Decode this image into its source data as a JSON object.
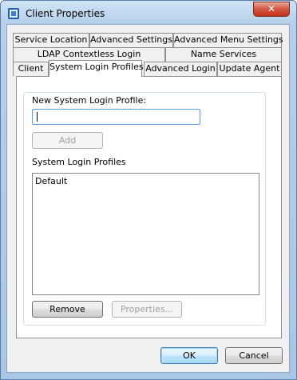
{
  "window": {
    "title": "Client Properties",
    "close_glyph": "✕"
  },
  "tabs": {
    "row1": [
      "Service Location",
      "Advanced Settings",
      "Advanced Menu Settings"
    ],
    "row2": [
      "LDAP Contextless Login",
      "Name Services"
    ],
    "row3": [
      "Client",
      "System Login Profiles",
      "Advanced Login",
      "Update Agent"
    ],
    "active": "System Login Profiles"
  },
  "panel": {
    "new_profile_label": "New System Login Profile:",
    "new_profile_value": "",
    "add_label": "Add",
    "profiles_label": "System Login Profiles",
    "profiles": [
      "Default"
    ],
    "remove_label": "Remove",
    "properties_label": "Properties..."
  },
  "footer": {
    "ok_label": "OK",
    "cancel_label": "Cancel"
  },
  "icons": {
    "app": "client-properties-icon",
    "close": "close-icon"
  },
  "colors": {
    "title_bar": "#b6d0ea",
    "close_button": "#c2331c",
    "focus_border": "#569de5",
    "default_button": "#3c7fb1"
  }
}
